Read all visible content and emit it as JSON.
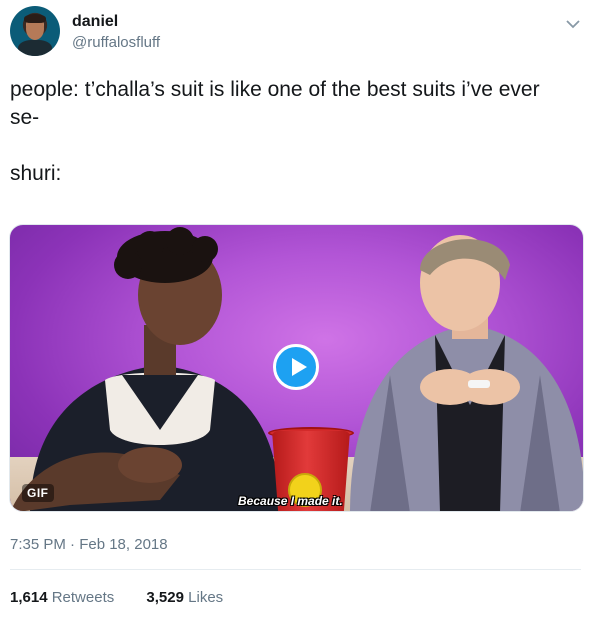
{
  "author": {
    "name": "daniel",
    "handle": "@ruffalosfluff",
    "avatar_icon": "profile-avatar"
  },
  "tweet": {
    "text": "people: t’challa’s suit is like one of the best suits i’ve ever se-\n\nshuri:"
  },
  "media": {
    "badge": "GIF",
    "caption": "Because I made it.",
    "play_icon": "play-icon"
  },
  "meta": {
    "timestamp": "7:35 PM · Feb 18, 2018"
  },
  "stats": {
    "retweets_count": "1,614",
    "retweets_label": "Retweets",
    "likes_count": "3,529",
    "likes_label": "Likes"
  },
  "colors": {
    "accent": "#1da1f2",
    "secondary_text": "#657786",
    "primary_text": "#14171a"
  }
}
